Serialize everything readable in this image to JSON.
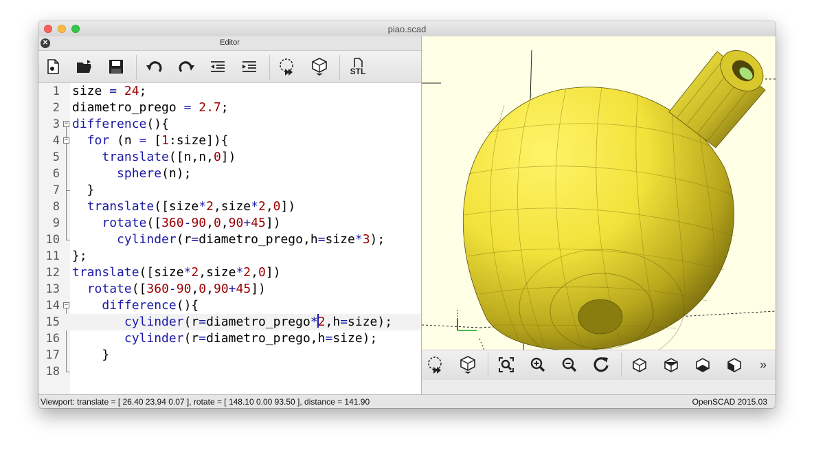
{
  "window": {
    "title": "piao.scad"
  },
  "editor": {
    "dock_title": "Editor",
    "toolbar": {
      "new_icon": "new-file-icon",
      "open_icon": "open-folder-icon",
      "save_icon": "save-disk-icon",
      "undo_icon": "undo-icon",
      "redo_icon": "redo-icon",
      "unindent_icon": "unindent-icon",
      "indent_icon": "indent-icon",
      "preview_icon": "preview-icon",
      "render_icon": "render-icon",
      "export_stl_label": "STL"
    },
    "current_line": 15,
    "lines": [
      {
        "num": "1"
      },
      {
        "num": "2"
      },
      {
        "num": "3"
      },
      {
        "num": "4"
      },
      {
        "num": "5"
      },
      {
        "num": "6"
      },
      {
        "num": "7"
      },
      {
        "num": "8"
      },
      {
        "num": "9"
      },
      {
        "num": "10"
      },
      {
        "num": "11"
      },
      {
        "num": "12"
      },
      {
        "num": "13"
      },
      {
        "num": "14"
      },
      {
        "num": "15"
      },
      {
        "num": "16"
      },
      {
        "num": "17"
      },
      {
        "num": "18"
      }
    ],
    "tokens": {
      "l1": [
        "size ",
        "=",
        " ",
        "24",
        ";"
      ],
      "l2": [
        "diametro_prego ",
        "=",
        " ",
        "2.7",
        ";"
      ],
      "l3": [
        "difference",
        "(){"
      ],
      "l4": [
        "  ",
        "for",
        " (n ",
        "=",
        " [",
        "1",
        ":size]){"
      ],
      "l5": [
        "    ",
        "translate",
        "([n,n,",
        "0",
        "])"
      ],
      "l6": [
        "      ",
        "sphere",
        "(n);"
      ],
      "l7": [
        "  }"
      ],
      "l8": [
        "  ",
        "translate",
        "([size",
        "*",
        "2",
        ",size",
        "*",
        "2",
        ",",
        "0",
        "])"
      ],
      "l9": [
        "    ",
        "rotate",
        "([",
        "360",
        "-",
        "90",
        ",",
        "0",
        ",",
        "90",
        "+",
        "45",
        "])"
      ],
      "l10": [
        "      ",
        "cylinder",
        "(r",
        "=",
        "diametro_prego,h",
        "=",
        "size",
        "*",
        "3",
        ");"
      ],
      "l11": [
        "};"
      ],
      "l12": [
        "translate",
        "([size",
        "*",
        "2",
        ",size",
        "*",
        "2",
        ",",
        "0",
        "])"
      ],
      "l13": [
        "  ",
        "rotate",
        "([",
        "360",
        "-",
        "90",
        ",",
        "0",
        ",",
        "90",
        "+",
        "45",
        "])"
      ],
      "l14": [
        "    ",
        "difference",
        "(){"
      ],
      "l15": [
        "       ",
        "cylinder",
        "(r",
        "=",
        "diametro_prego",
        "*",
        "2",
        ",h",
        "=",
        "size);"
      ],
      "l16": [
        "       ",
        "cylinder",
        "(r",
        "=",
        "diametro_prego,h",
        "=",
        "size);"
      ],
      "l17": [
        "    }"
      ],
      "l18": [
        ""
      ]
    }
  },
  "viewport": {
    "toolbar_icons": [
      "preview-icon",
      "render-icon",
      "view-all-icon",
      "zoom-in-icon",
      "zoom-out-icon",
      "reset-view-icon",
      "view-right-icon",
      "view-top-icon",
      "view-bottom-icon",
      "view-left-icon",
      "more-icon"
    ],
    "more_label": "»",
    "colors": {
      "background": "#ffffe6",
      "model_yellow": "#f2e23a",
      "model_shadow": "#8a7d10"
    }
  },
  "status": {
    "viewport_info": "Viewport: translate = [ 26.40 23.94 0.07 ], rotate = [ 148.10 0.00 93.50 ], distance = 141.90",
    "version": "OpenSCAD 2015.03"
  }
}
